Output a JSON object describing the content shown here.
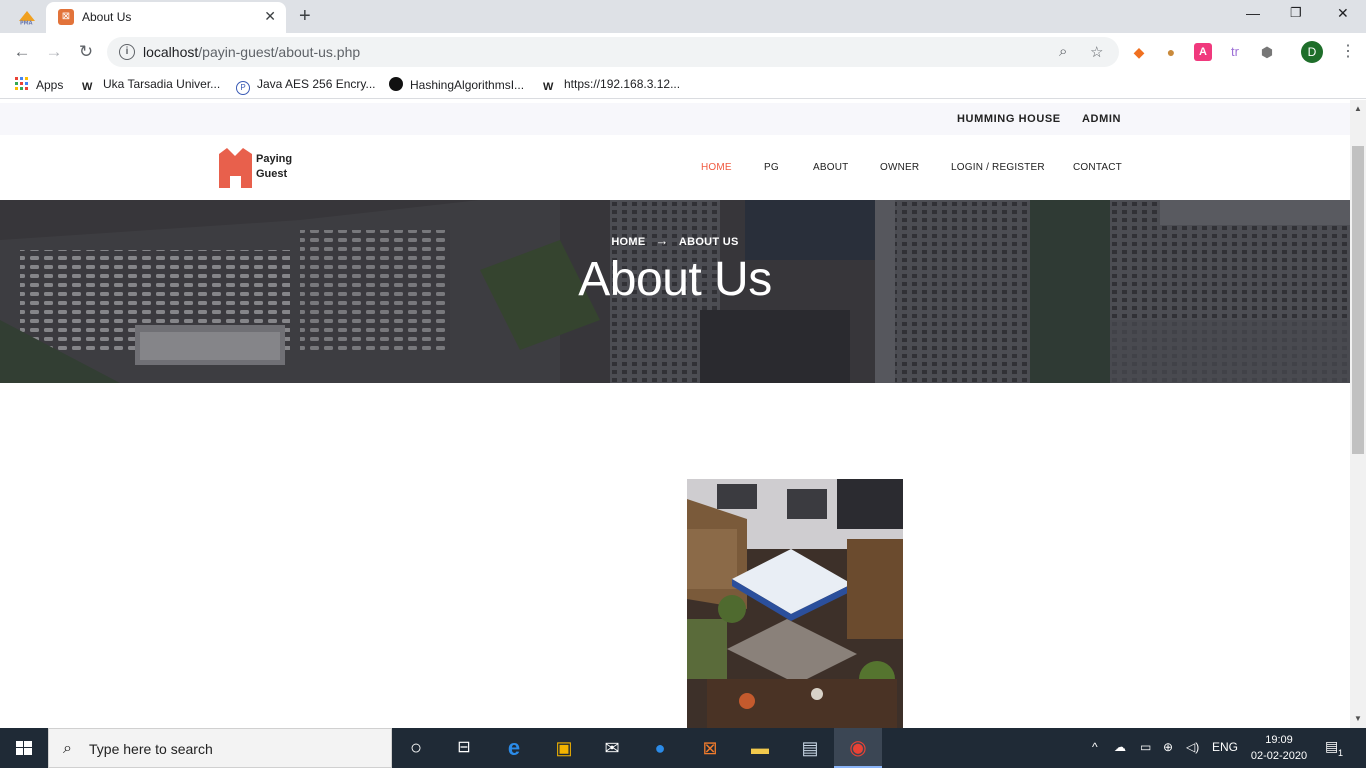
{
  "browser": {
    "tab_title": "About Us",
    "url_host": "localhost",
    "url_path": "/payin-guest/about-us.php",
    "profile_initial": "D",
    "bookmarks": [
      {
        "label": "Apps",
        "icon": "apps-grid-icon"
      },
      {
        "label": "Uka Tarsadia Univer...",
        "icon": "w-site-icon"
      },
      {
        "label": "Java AES 256 Encry...",
        "icon": "java-site-icon"
      },
      {
        "label": "HashingAlgorithmsI...",
        "icon": "github-icon"
      },
      {
        "label": "https://192.168.3.12...",
        "icon": "w-site-icon"
      }
    ]
  },
  "site": {
    "topbar": {
      "links": [
        "HUMMING HOUSE",
        "ADMIN"
      ]
    },
    "logo": {
      "line1": "Paying",
      "line2": "Guest"
    },
    "nav": [
      {
        "label": "HOME",
        "active": true
      },
      {
        "label": "PG",
        "active": false
      },
      {
        "label": "ABOUT",
        "active": false
      },
      {
        "label": "OWNER",
        "active": false
      },
      {
        "label": "LOGIN / REGISTER",
        "active": false
      },
      {
        "label": "CONTACT",
        "active": false
      }
    ],
    "hero": {
      "breadcrumb_home": "HOME",
      "breadcrumb_current": "ABOUT US",
      "title": "About Us"
    },
    "colors": {
      "accent": "#f05a40",
      "logo": "#e8604c"
    }
  },
  "taskbar": {
    "search_placeholder": "Type here to search",
    "language": "ENG",
    "time": "19:09",
    "date": "02-02-2020",
    "notification_count": "1"
  }
}
